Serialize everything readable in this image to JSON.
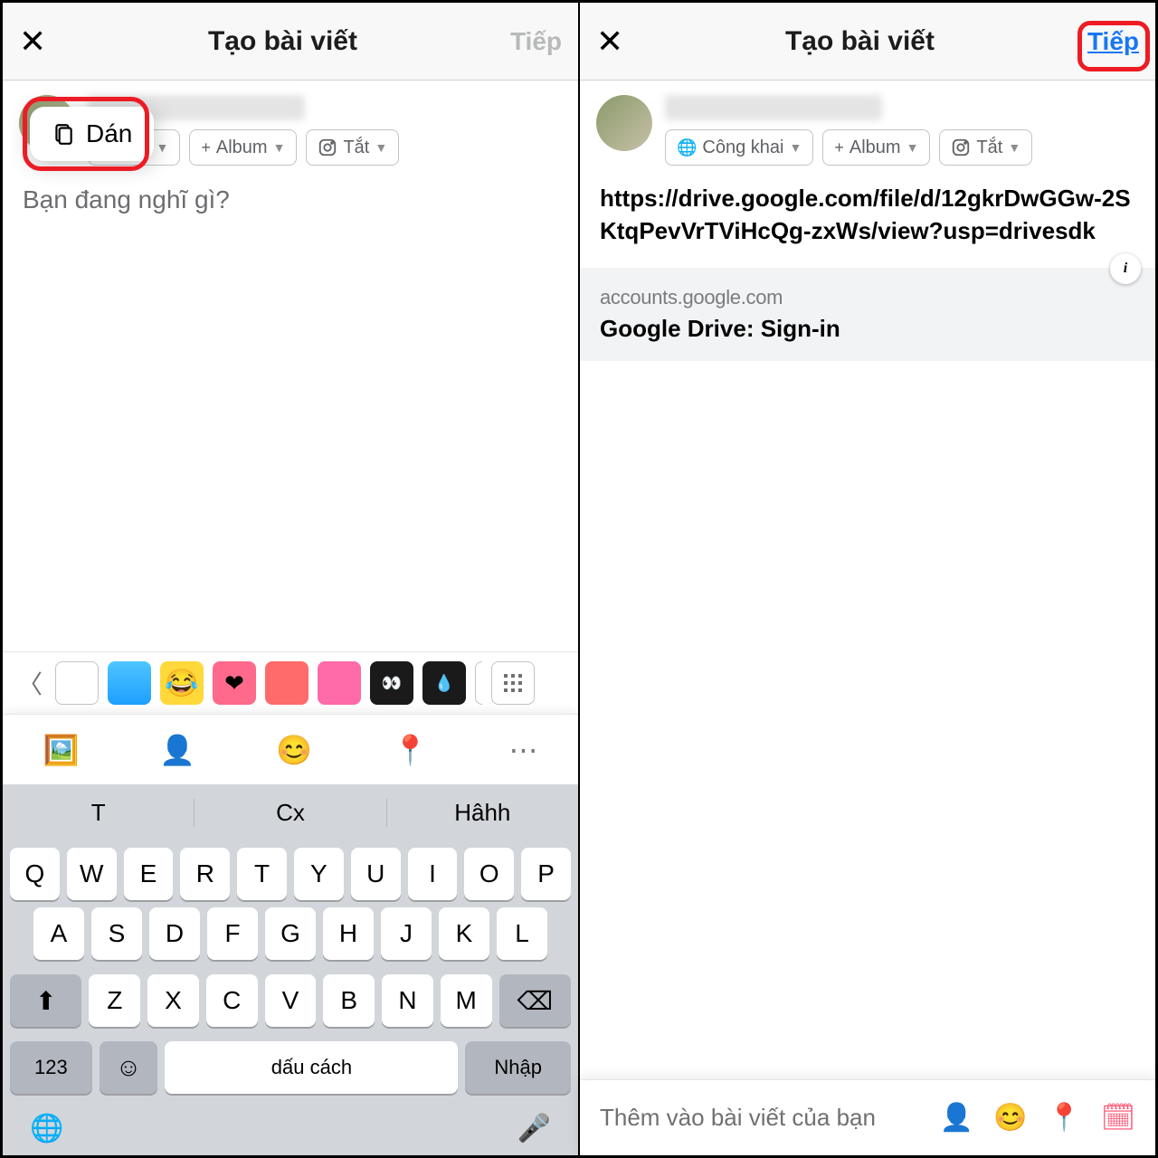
{
  "header": {
    "title": "Tạo bài viết",
    "next_label": "Tiếp"
  },
  "popover": {
    "paste_label": "Dán"
  },
  "chips": {
    "privacy": {
      "icon": "🌐",
      "label": "Công khai"
    },
    "privacy_partial": "ng khai",
    "album": {
      "prefix": "+",
      "label": "Album"
    },
    "instagram": {
      "label": "Tắt"
    }
  },
  "placeholder": "Bạn đang nghĩ gì?",
  "post_text": "https://drive.google.com/file/d/12gkrDwGGw-2SKtqPevVrTViHcQg-zxWs/view?usp=drivesdk",
  "link_preview": {
    "domain": "accounts.google.com",
    "title": "Google Drive: Sign-in"
  },
  "keyboard": {
    "suggestions": [
      "T",
      "Cx",
      "Hâhh"
    ],
    "row1": [
      "Q",
      "W",
      "E",
      "R",
      "T",
      "Y",
      "U",
      "I",
      "O",
      "P"
    ],
    "row2": [
      "A",
      "S",
      "D",
      "F",
      "G",
      "H",
      "J",
      "K",
      "L"
    ],
    "row3": [
      "Z",
      "X",
      "C",
      "V",
      "B",
      "N",
      "M"
    ],
    "num": "123",
    "space": "dấu cách",
    "enter": "Nhập"
  },
  "addbar_label": "Thêm vào bài viết của bạn"
}
